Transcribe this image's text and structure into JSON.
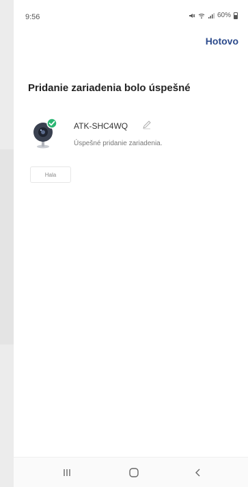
{
  "status_bar": {
    "time": "9:56",
    "battery": "60%"
  },
  "header": {
    "done_label": "Hotovo"
  },
  "main": {
    "title": "Pridanie zariadenia bolo úspešné",
    "device": {
      "name": "ATK-SHC4WQ",
      "status": "Úspešné pridanie zariadenia."
    },
    "room_chip": "Hala"
  },
  "icons": {
    "device": "camera-device-icon",
    "success": "check-badge-icon",
    "edit": "pencil-icon",
    "nav_recents": "recents-icon",
    "nav_home": "home-icon",
    "nav_back": "back-icon"
  },
  "colors": {
    "accent": "#2b4a8c",
    "success": "#2bb673"
  }
}
